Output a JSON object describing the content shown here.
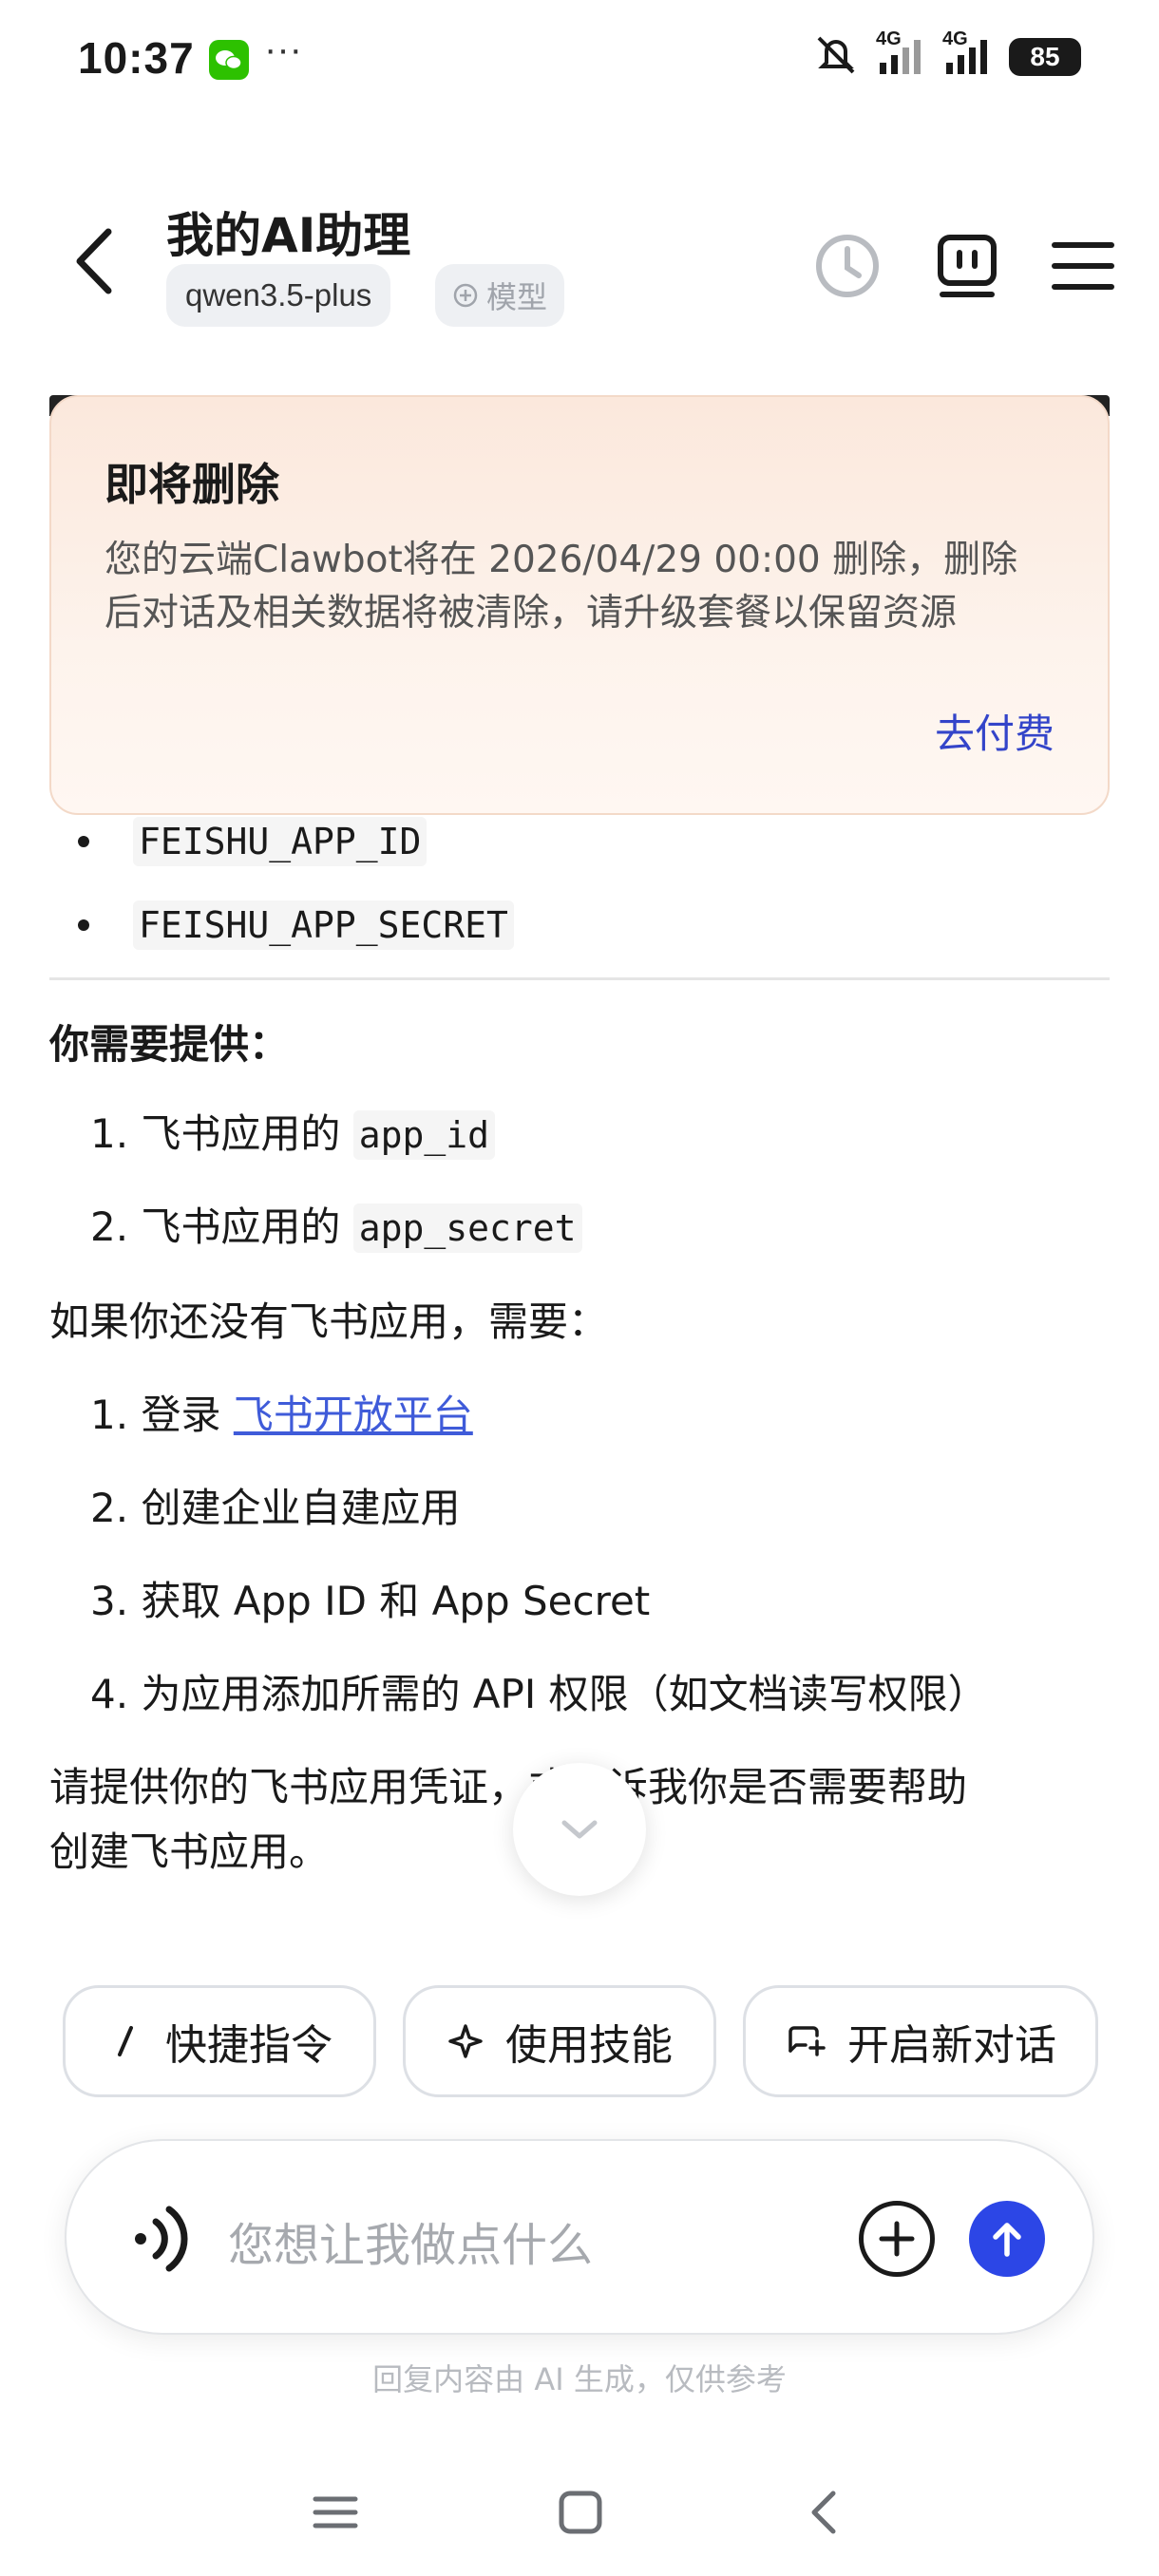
{
  "status_bar": {
    "time": "10:37",
    "dots": "···",
    "network_1": "4G",
    "network_2": "4G",
    "battery": "85"
  },
  "header": {
    "title": "我的AI助理",
    "model": "qwen3.5-plus",
    "add_model_label": "模型"
  },
  "alert": {
    "title": "即将删除",
    "body": "您的云端Clawbot将在 2026/04/29 00:00 删除，删除后对话及相关数据将被清除，请升级套餐以保留资源",
    "action": "去付费"
  },
  "content": {
    "env_vars": [
      "FEISHU_APP_ID",
      "FEISHU_APP_SECRET"
    ],
    "need_heading": "你需要提供：",
    "need_items": [
      {
        "prefix": "1. 飞书应用的 ",
        "code": "app_id"
      },
      {
        "prefix": "2. 飞书应用的 ",
        "code": "app_secret"
      }
    ],
    "no_app_heading": "如果你还没有飞书应用，需要：",
    "steps": [
      {
        "num": "1. ",
        "text": "登录 ",
        "link": "飞书开放平台"
      },
      {
        "num": "2. ",
        "text": "创建企业自建应用"
      },
      {
        "num": "3. ",
        "text": "获取 App ID 和 App Secret"
      },
      {
        "num": "4. ",
        "text": "为应用添加所需的 API 权限（如文档读写权限）"
      }
    ],
    "closing_line_1": "请提供你的飞书应用凭证，或告诉我你是否需要帮助",
    "closing_line_2": "创建飞书应用。"
  },
  "quick_actions": [
    {
      "label": "快捷指令",
      "icon": "slash-icon"
    },
    {
      "label": "使用技能",
      "icon": "sparkle-icon"
    },
    {
      "label": "开启新对话",
      "icon": "new-chat-icon"
    }
  ],
  "input": {
    "placeholder": "您想让我做点什么"
  },
  "disclaimer": "回复内容由 AI 生成，仅供参考",
  "colors": {
    "accent": "#2c46e6",
    "link": "#3f5bd9",
    "alert_bg": "#fbe8dc"
  }
}
